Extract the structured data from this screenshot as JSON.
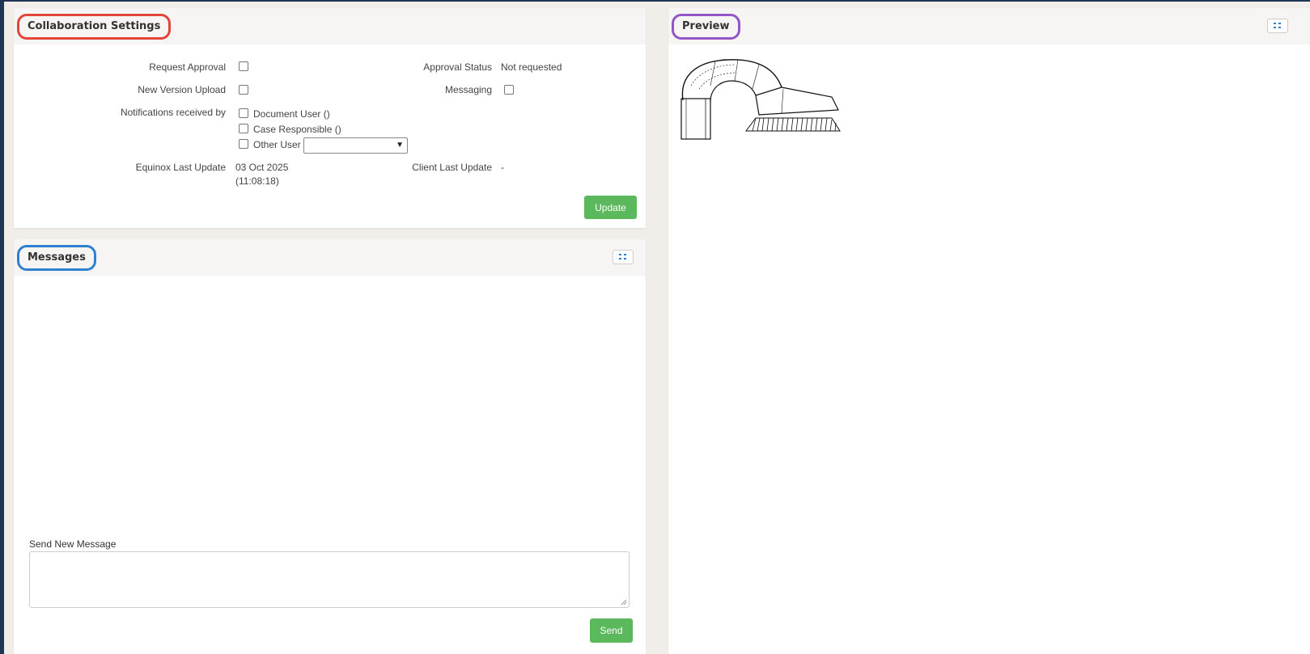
{
  "collab": {
    "title": "Collaboration Settings",
    "request_approval_label": "Request Approval",
    "approval_status_label": "Approval Status",
    "approval_status_value": "Not requested",
    "new_version_upload_label": "New Version Upload",
    "messaging_label": "Messaging",
    "notifications_label": "Notifications received by",
    "notify_options": [
      "Document User ()",
      "Case Responsible ()",
      "Other User"
    ],
    "other_user_selected": "",
    "equinox_last_update_label": "Equinox Last Update",
    "equinox_last_update_date": "03 Oct 2025",
    "equinox_last_update_time": "(11:08:18)",
    "client_last_update_label": "Client Last Update",
    "client_last_update_value": "-",
    "update_button": "Update"
  },
  "messages": {
    "title": "Messages",
    "send_new_label": "Send New Message",
    "message_value": "",
    "send_button": "Send"
  },
  "preview": {
    "title": "Preview"
  },
  "icons": {
    "toggle": "grid-toggle-icon",
    "caret": "chevron-down-icon"
  },
  "colors": {
    "accent_green": "#5cb85c",
    "title_red": "#e2443a",
    "title_blue": "#2f80d1",
    "title_purple": "#9256c7",
    "rail": "#1f3552"
  }
}
